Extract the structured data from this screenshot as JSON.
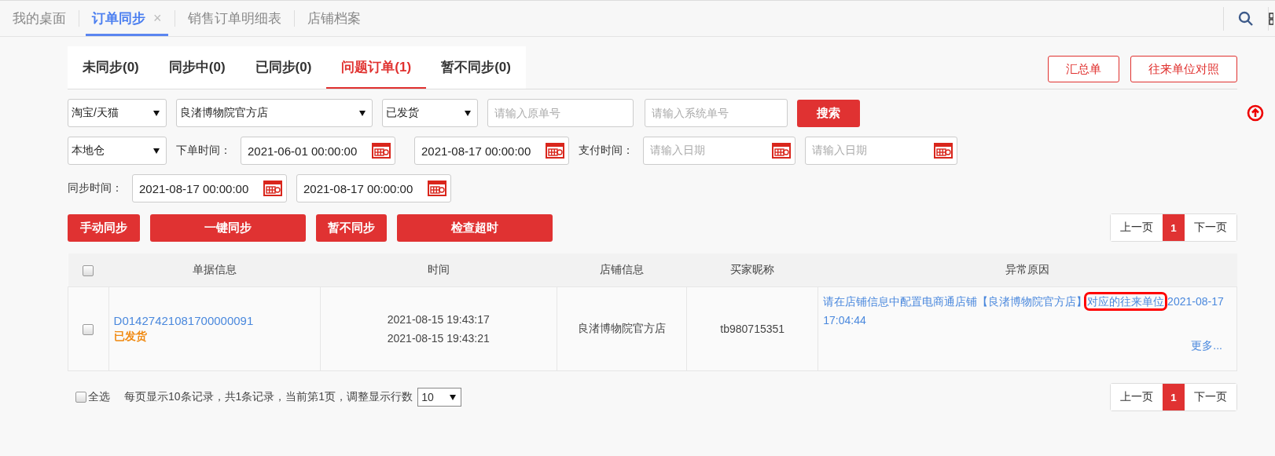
{
  "top_tabs": [
    {
      "label": "我的桌面",
      "selected": false
    },
    {
      "label": "订单同步",
      "selected": true,
      "close": "×"
    },
    {
      "label": "销售订单明细表",
      "selected": false
    },
    {
      "label": "店铺档案",
      "selected": false
    }
  ],
  "status_tabs": [
    {
      "label": "未同步(0)",
      "selected": false
    },
    {
      "label": "同步中(0)",
      "selected": false
    },
    {
      "label": "已同步(0)",
      "selected": false
    },
    {
      "label": "问题订单(1)",
      "selected": true
    },
    {
      "label": "暂不同步(0)",
      "selected": false
    }
  ],
  "header_buttons": [
    "汇总单",
    "往来单位对照"
  ],
  "filters": {
    "platform": {
      "value": "淘宝/天猫"
    },
    "shop": {
      "value": "良渚博物院官方店"
    },
    "status": {
      "value": "已发货"
    },
    "original_no": {
      "placeholder": "请输入原单号"
    },
    "system_no": {
      "placeholder": "请输入系统单号"
    },
    "search_button": "搜索",
    "warehouse": {
      "value": "本地仓"
    },
    "order_time": {
      "label": "下单时间：",
      "from": "2021-06-01 00:00:00",
      "to": "2021-08-17 00:00:00"
    },
    "pay_time": {
      "label": "支付时间：",
      "from_placeholder": "请输入日期",
      "to_placeholder": "请输入日期"
    },
    "sync_time": {
      "label": "同步时间：",
      "from": "2021-08-17 00:00:00",
      "to": "2021-08-17 00:00:00"
    }
  },
  "actions": [
    "手动同步",
    "一键同步",
    "暂不同步",
    "检查超时"
  ],
  "pagination_top": {
    "prev": "上一页",
    "pages": [
      {
        "label": "1",
        "selected": true
      }
    ],
    "next": "下一页"
  },
  "table": {
    "header_checked": false,
    "columns": [
      "单据信息",
      "时间",
      "店铺信息",
      "买家昵称",
      "异常原因"
    ],
    "rows": [
      {
        "checked": false,
        "order_no": "D01427421081700000091",
        "status": "已发货",
        "times": [
          "2021-08-15 19:43:17",
          "2021-08-15 19:43:21"
        ],
        "shop": "良渚博物院官方店",
        "buyer": "tb980715351",
        "reason": {
          "before": "请在店铺信息中配置电商通店铺【良渚博物院官方店】",
          "highlight": "对应的往来单位",
          "after": " 2021-08-17 17:04:44"
        },
        "more": "更多..."
      }
    ]
  },
  "footer": {
    "select_all": {
      "label": "全选",
      "checked": false
    },
    "summary": "每页显示10条记录，共1条记录，当前第1页，调整显示行数",
    "page_size": "10"
  },
  "pagination_bottom": {
    "prev": "上一页",
    "pages": [
      {
        "label": "1",
        "selected": true
      }
    ],
    "next": "下一页"
  }
}
